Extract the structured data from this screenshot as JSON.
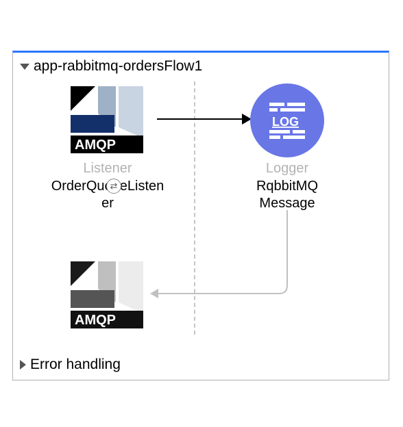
{
  "flow": {
    "title": "app-rabbitmq-ordersFlow1",
    "error_section_label": "Error handling",
    "nodes": {
      "listener": {
        "connector_label": "Listener",
        "name": "OrderQueueListen​er",
        "icon_text": "AMQP"
      },
      "logger": {
        "connector_label": "Logger",
        "name": "RqbbitMQ Message",
        "icon_text": "LOG"
      },
      "amqp_out": {
        "icon_text": "AMQP"
      }
    }
  }
}
